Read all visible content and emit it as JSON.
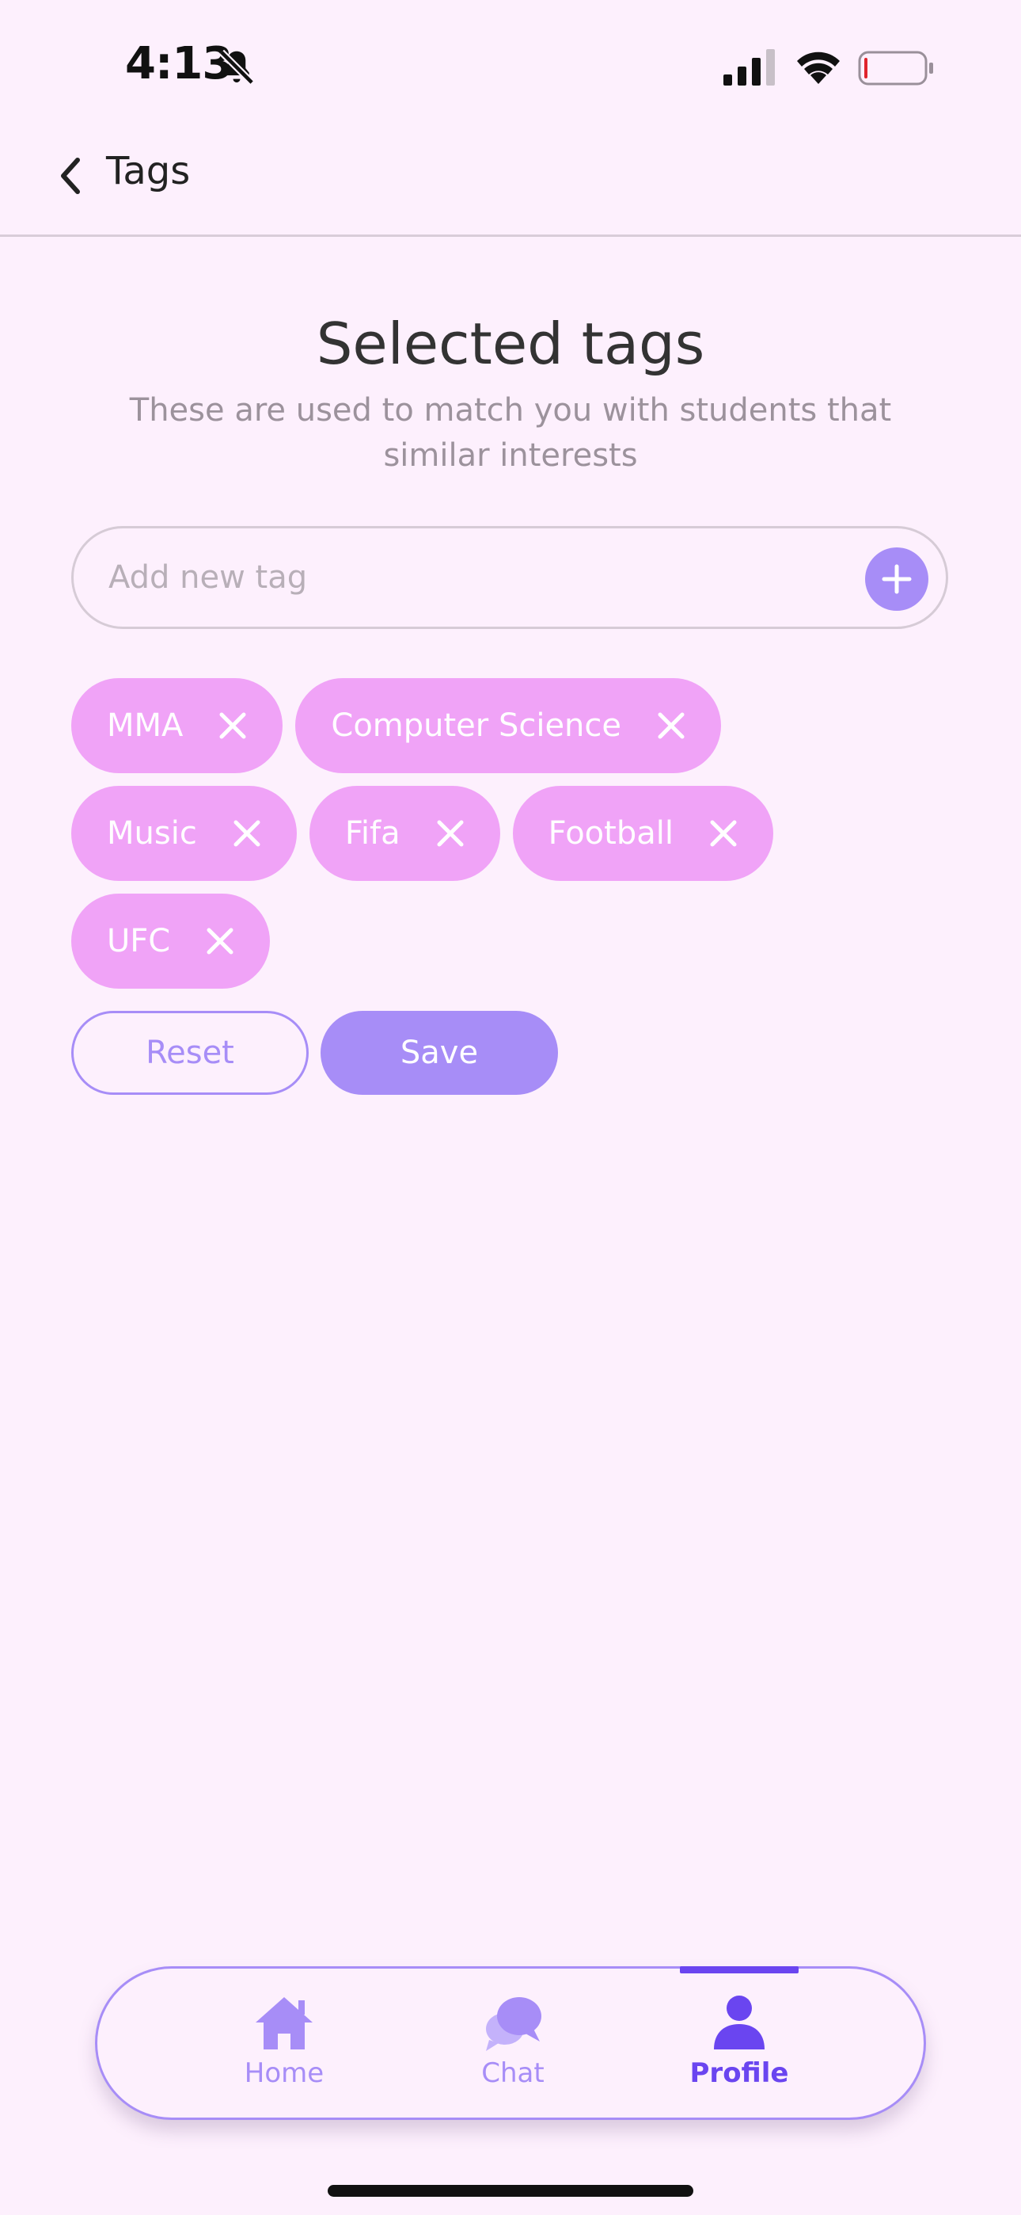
{
  "status_bar": {
    "time": "4:13",
    "icons": [
      "bell-slash-icon",
      "cellular-signal-icon",
      "wifi-icon",
      "battery-icon"
    ]
  },
  "header": {
    "back_icon": "chevron-left-icon",
    "title": "Tags"
  },
  "main": {
    "title": "Selected tags",
    "subtitle": "These are used to match you with students that similar interests",
    "tag_input": {
      "value": "",
      "placeholder": "Add new tag",
      "add_icon": "plus-icon"
    },
    "tags": [
      {
        "label": "MMA"
      },
      {
        "label": "Computer Science"
      },
      {
        "label": "Music"
      },
      {
        "label": "Fifa"
      },
      {
        "label": "Football"
      },
      {
        "label": "UFC"
      }
    ],
    "reset_label": "Reset",
    "save_label": "Save"
  },
  "bottom_nav": {
    "items": [
      {
        "label": "Home",
        "icon": "home-icon",
        "active": false
      },
      {
        "label": "Chat",
        "icon": "chat-icon",
        "active": false
      },
      {
        "label": "Profile",
        "icon": "profile-icon",
        "active": true
      }
    ]
  },
  "colors": {
    "background": "#fdf0fd",
    "accent": "#a78df7",
    "accent_active": "#6a45f0",
    "chip": "#f0a3f7"
  }
}
